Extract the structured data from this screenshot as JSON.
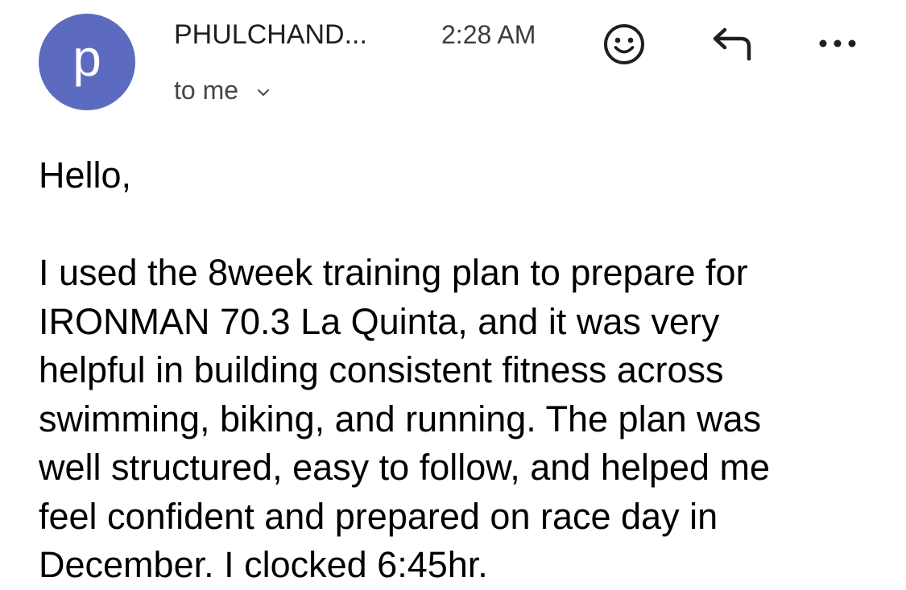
{
  "header": {
    "avatar_letter": "p",
    "sender": "PHULCHAND...",
    "time": "2:28 AM",
    "recipient_label": "to me",
    "avatar_color": "#5c6bc0"
  },
  "actions": {
    "emoji_icon": "smiley-face-icon",
    "reply_icon": "reply-arrow-icon",
    "more_icon": "more-horizontal-icon",
    "expand_icon": "chevron-down-icon"
  },
  "message": {
    "greeting": "Hello,",
    "lines": [
      "I used the 8week training plan to prepare for",
      "IRONMAN 70.3 La Quinta, and it was very",
      "helpful in building consistent fitness across",
      "swimming, biking, and running. The plan was",
      "well structured, easy to follow, and helped me",
      "feel confident and prepared on race day in",
      "December. I clocked 6:45hr."
    ]
  }
}
